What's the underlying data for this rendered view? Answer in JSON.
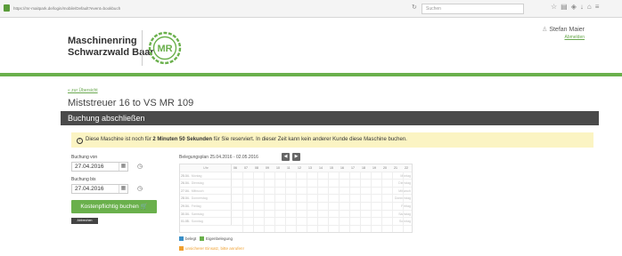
{
  "browser": {
    "url": "https://mr-maitpark.de/login/mobile/Default?event=bookbuch",
    "search_placeholder": "Suchen",
    "icons": [
      "lock-icon",
      "reload-icon",
      "star-icon",
      "bookmarks-icon",
      "pocket-icon",
      "download-icon",
      "home-icon",
      "menu-icon"
    ]
  },
  "header": {
    "brand_line1": "Maschinenring",
    "brand_line2": "Schwarzwald Baar",
    "logo_text": "MR",
    "user_name": "Stefan Maier",
    "logout": "Abmelden"
  },
  "main": {
    "back_link": "« zur Übersicht",
    "machine_title": "Miststreuer 16 to VS MR 109",
    "panel_title": "Buchung abschließen",
    "notice_before": "Diese Maschine ist noch für ",
    "notice_strong": "2 Minuten 50 Sekunden",
    "notice_after": " für Sie reserviert. In dieser Zeit kann kein anderer Kunde diese Maschine buchen."
  },
  "form": {
    "from_label": "Buchung von",
    "from_value": "27.04.2016",
    "to_label": "Buchung bis",
    "to_value": "27.04.2016",
    "book_button": "Kostenpflichtig buchen",
    "cancel_button": "Abbrechen"
  },
  "plan": {
    "title": "Belegungsplan 25.04.2016 - 02.05.2016",
    "time_header": "Uhr",
    "hours": [
      "06",
      "07",
      "08",
      "09",
      "10",
      "11",
      "12",
      "13",
      "14",
      "15",
      "16",
      "17",
      "18",
      "19",
      "20",
      "21",
      "22"
    ],
    "days": [
      {
        "date": "25.04.",
        "name": "Montag"
      },
      {
        "date": "26.04.",
        "name": "Dienstag"
      },
      {
        "date": "27.04.",
        "name": "Mittwoch"
      },
      {
        "date": "28.04.",
        "name": "Donnerstag"
      },
      {
        "date": "29.04.",
        "name": "Freitag"
      },
      {
        "date": "30.04.",
        "name": "Samstag"
      },
      {
        "date": "01.05.",
        "name": "Sonntag"
      }
    ],
    "legend": [
      {
        "label": "belegt",
        "color": "#3a8fc7"
      },
      {
        "label": "Eigenbelegung",
        "color": "#6ab04c"
      },
      {
        "label": "unsicherer Einsatz, bitte anrufen!",
        "color": "#f0a030"
      }
    ]
  },
  "colors": {
    "accent": "#6ab04c",
    "panel": "#4a4a4a",
    "notice": "#fbf4c3"
  }
}
